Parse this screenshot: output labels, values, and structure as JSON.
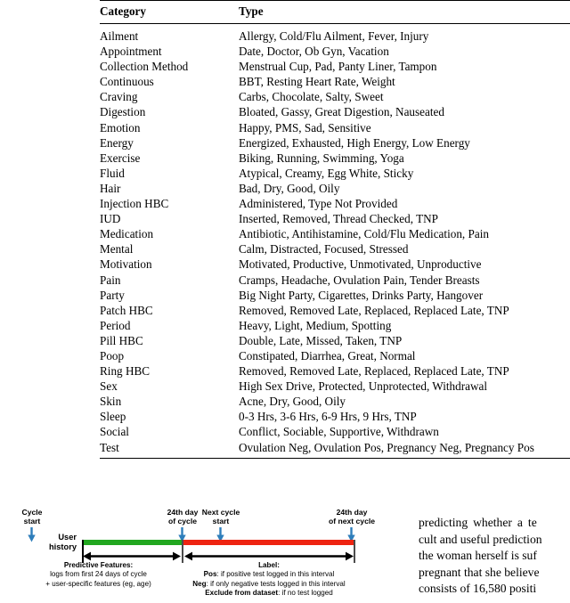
{
  "table": {
    "headers": {
      "category": "Category",
      "type": "Type"
    },
    "rows": [
      {
        "category": "Ailment",
        "type": "Allergy, Cold/Flu Ailment, Fever, Injury"
      },
      {
        "category": "Appointment",
        "type": "Date, Doctor, Ob Gyn, Vacation"
      },
      {
        "category": "Collection Method",
        "type": "Menstrual Cup, Pad, Panty Liner, Tampon"
      },
      {
        "category": "Continuous",
        "type": "BBT, Resting Heart Rate, Weight"
      },
      {
        "category": "Craving",
        "type": "Carbs, Chocolate, Salty, Sweet"
      },
      {
        "category": "Digestion",
        "type": "Bloated, Gassy, Great Digestion, Nauseated"
      },
      {
        "category": "Emotion",
        "type": "Happy, PMS, Sad, Sensitive"
      },
      {
        "category": "Energy",
        "type": "Energized, Exhausted, High Energy, Low Energy"
      },
      {
        "category": "Exercise",
        "type": "Biking, Running, Swimming, Yoga"
      },
      {
        "category": "Fluid",
        "type": "Atypical, Creamy, Egg White, Sticky"
      },
      {
        "category": "Hair",
        "type": "Bad, Dry, Good, Oily"
      },
      {
        "category": "Injection HBC",
        "type": "Administered, Type Not Provided"
      },
      {
        "category": "IUD",
        "type": "Inserted, Removed, Thread Checked, TNP"
      },
      {
        "category": "Medication",
        "type": "Antibiotic, Antihistamine, Cold/Flu Medication, Pain"
      },
      {
        "category": "Mental",
        "type": "Calm, Distracted, Focused, Stressed"
      },
      {
        "category": "Motivation",
        "type": "Motivated, Productive, Unmotivated, Unproductive"
      },
      {
        "category": "Pain",
        "type": "Cramps, Headache, Ovulation Pain, Tender Breasts"
      },
      {
        "category": "Party",
        "type": "Big Night Party, Cigarettes, Drinks Party, Hangover"
      },
      {
        "category": "Patch HBC",
        "type": "Removed, Removed Late, Replaced, Replaced Late, TNP"
      },
      {
        "category": "Period",
        "type": "Heavy, Light, Medium, Spotting"
      },
      {
        "category": "Pill HBC",
        "type": "Double, Late, Missed, Taken, TNP"
      },
      {
        "category": "Poop",
        "type": "Constipated, Diarrhea, Great, Normal"
      },
      {
        "category": "Ring HBC",
        "type": "Removed, Removed Late, Replaced, Replaced Late, TNP"
      },
      {
        "category": "Sex",
        "type": "High Sex Drive, Protected, Unprotected, Withdrawal"
      },
      {
        "category": "Skin",
        "type": "Acne, Dry, Good, Oily"
      },
      {
        "category": "Sleep",
        "type": "0-3 Hrs, 3-6 Hrs, 6-9 Hrs, 9 Hrs, TNP"
      },
      {
        "category": "Social",
        "type": "Conflict, Sociable, Supportive, Withdrawn"
      },
      {
        "category": "Test",
        "type": "Ovulation Neg, Ovulation Pos, Pregnancy Neg, Pregnancy Pos"
      }
    ]
  },
  "figure": {
    "axis_label_line1": "User",
    "axis_label_line2": "history",
    "markers": [
      {
        "line1": "Cycle",
        "line2": "start"
      },
      {
        "line1": "24th day",
        "line2": "of cycle"
      },
      {
        "line1": "Next cycle",
        "line2": "start"
      },
      {
        "line1": "24th day",
        "line2": "of next cycle"
      }
    ],
    "features": {
      "title": "Predictive Features:",
      "line1": "logs from first 24 days of cycle",
      "line2": "+ user-specific features (eg, age)"
    },
    "label": {
      "title": "Label:",
      "pos_key": "Pos",
      "pos_text": ": if positive test logged in this interval",
      "neg_key": "Neg",
      "neg_text": ": if only negative tests logged in this interval",
      "exclude_key": "Exclude from dataset",
      "exclude_text": ": if no test logged"
    },
    "colors": {
      "features_bar": "#22a720",
      "label_bar": "#ee2411",
      "marker_arrow": "#2e7ebb"
    }
  },
  "body_text": {
    "lines": [
      "predicting whether a te",
      "cult and useful prediction",
      "the woman herself is suf",
      "pregnant that she believe",
      "consists of 16,580 positi"
    ]
  }
}
